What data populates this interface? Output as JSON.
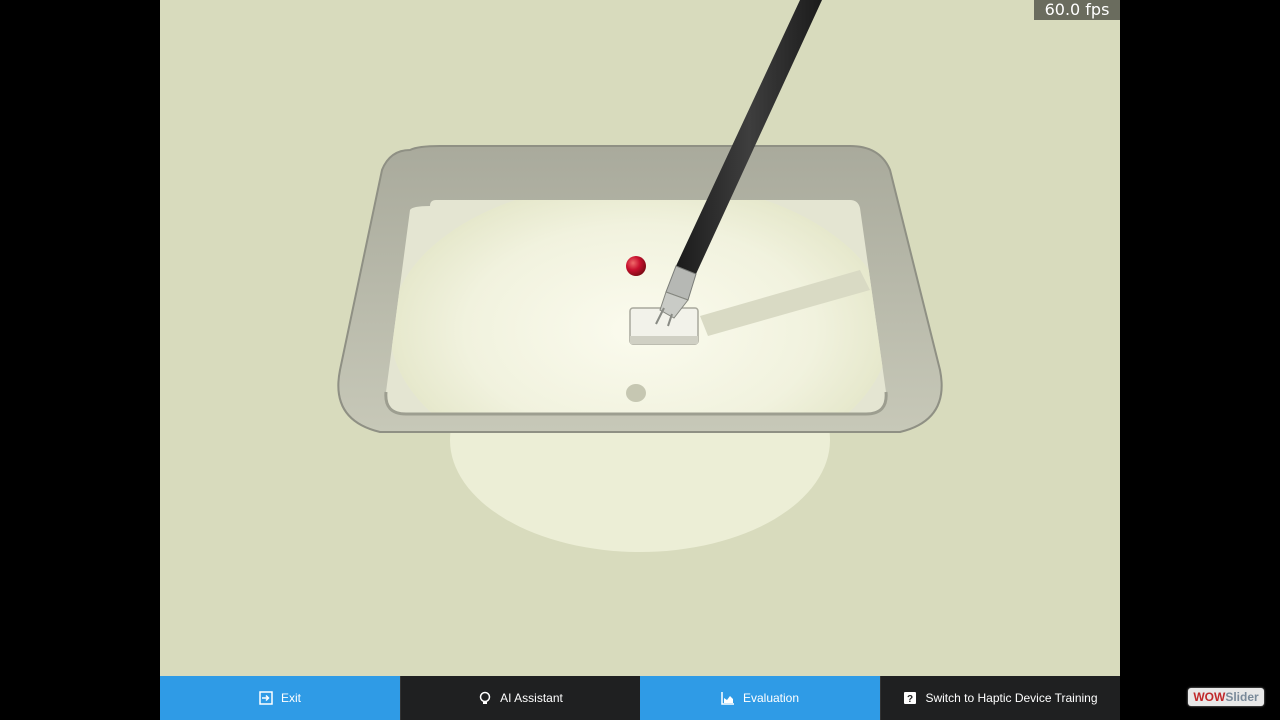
{
  "fps_text": "60.0 fps",
  "toolbar": {
    "exit_label": "Exit",
    "ai_label": "AI Assistant",
    "evaluation_label": "Evaluation",
    "haptic_label": "Switch to Haptic Device Training"
  },
  "watermark": {
    "part1": "WOW",
    "part2": "Slider"
  },
  "colors": {
    "background": "#d8dbbd",
    "tray": "#b4b4a4",
    "ball": "#c8102e",
    "toolbar_blue": "#2f9be6",
    "toolbar_dark": "#1f2021"
  },
  "icons": [
    "exit-icon",
    "lightbulb-icon",
    "chart-icon",
    "help-icon"
  ]
}
